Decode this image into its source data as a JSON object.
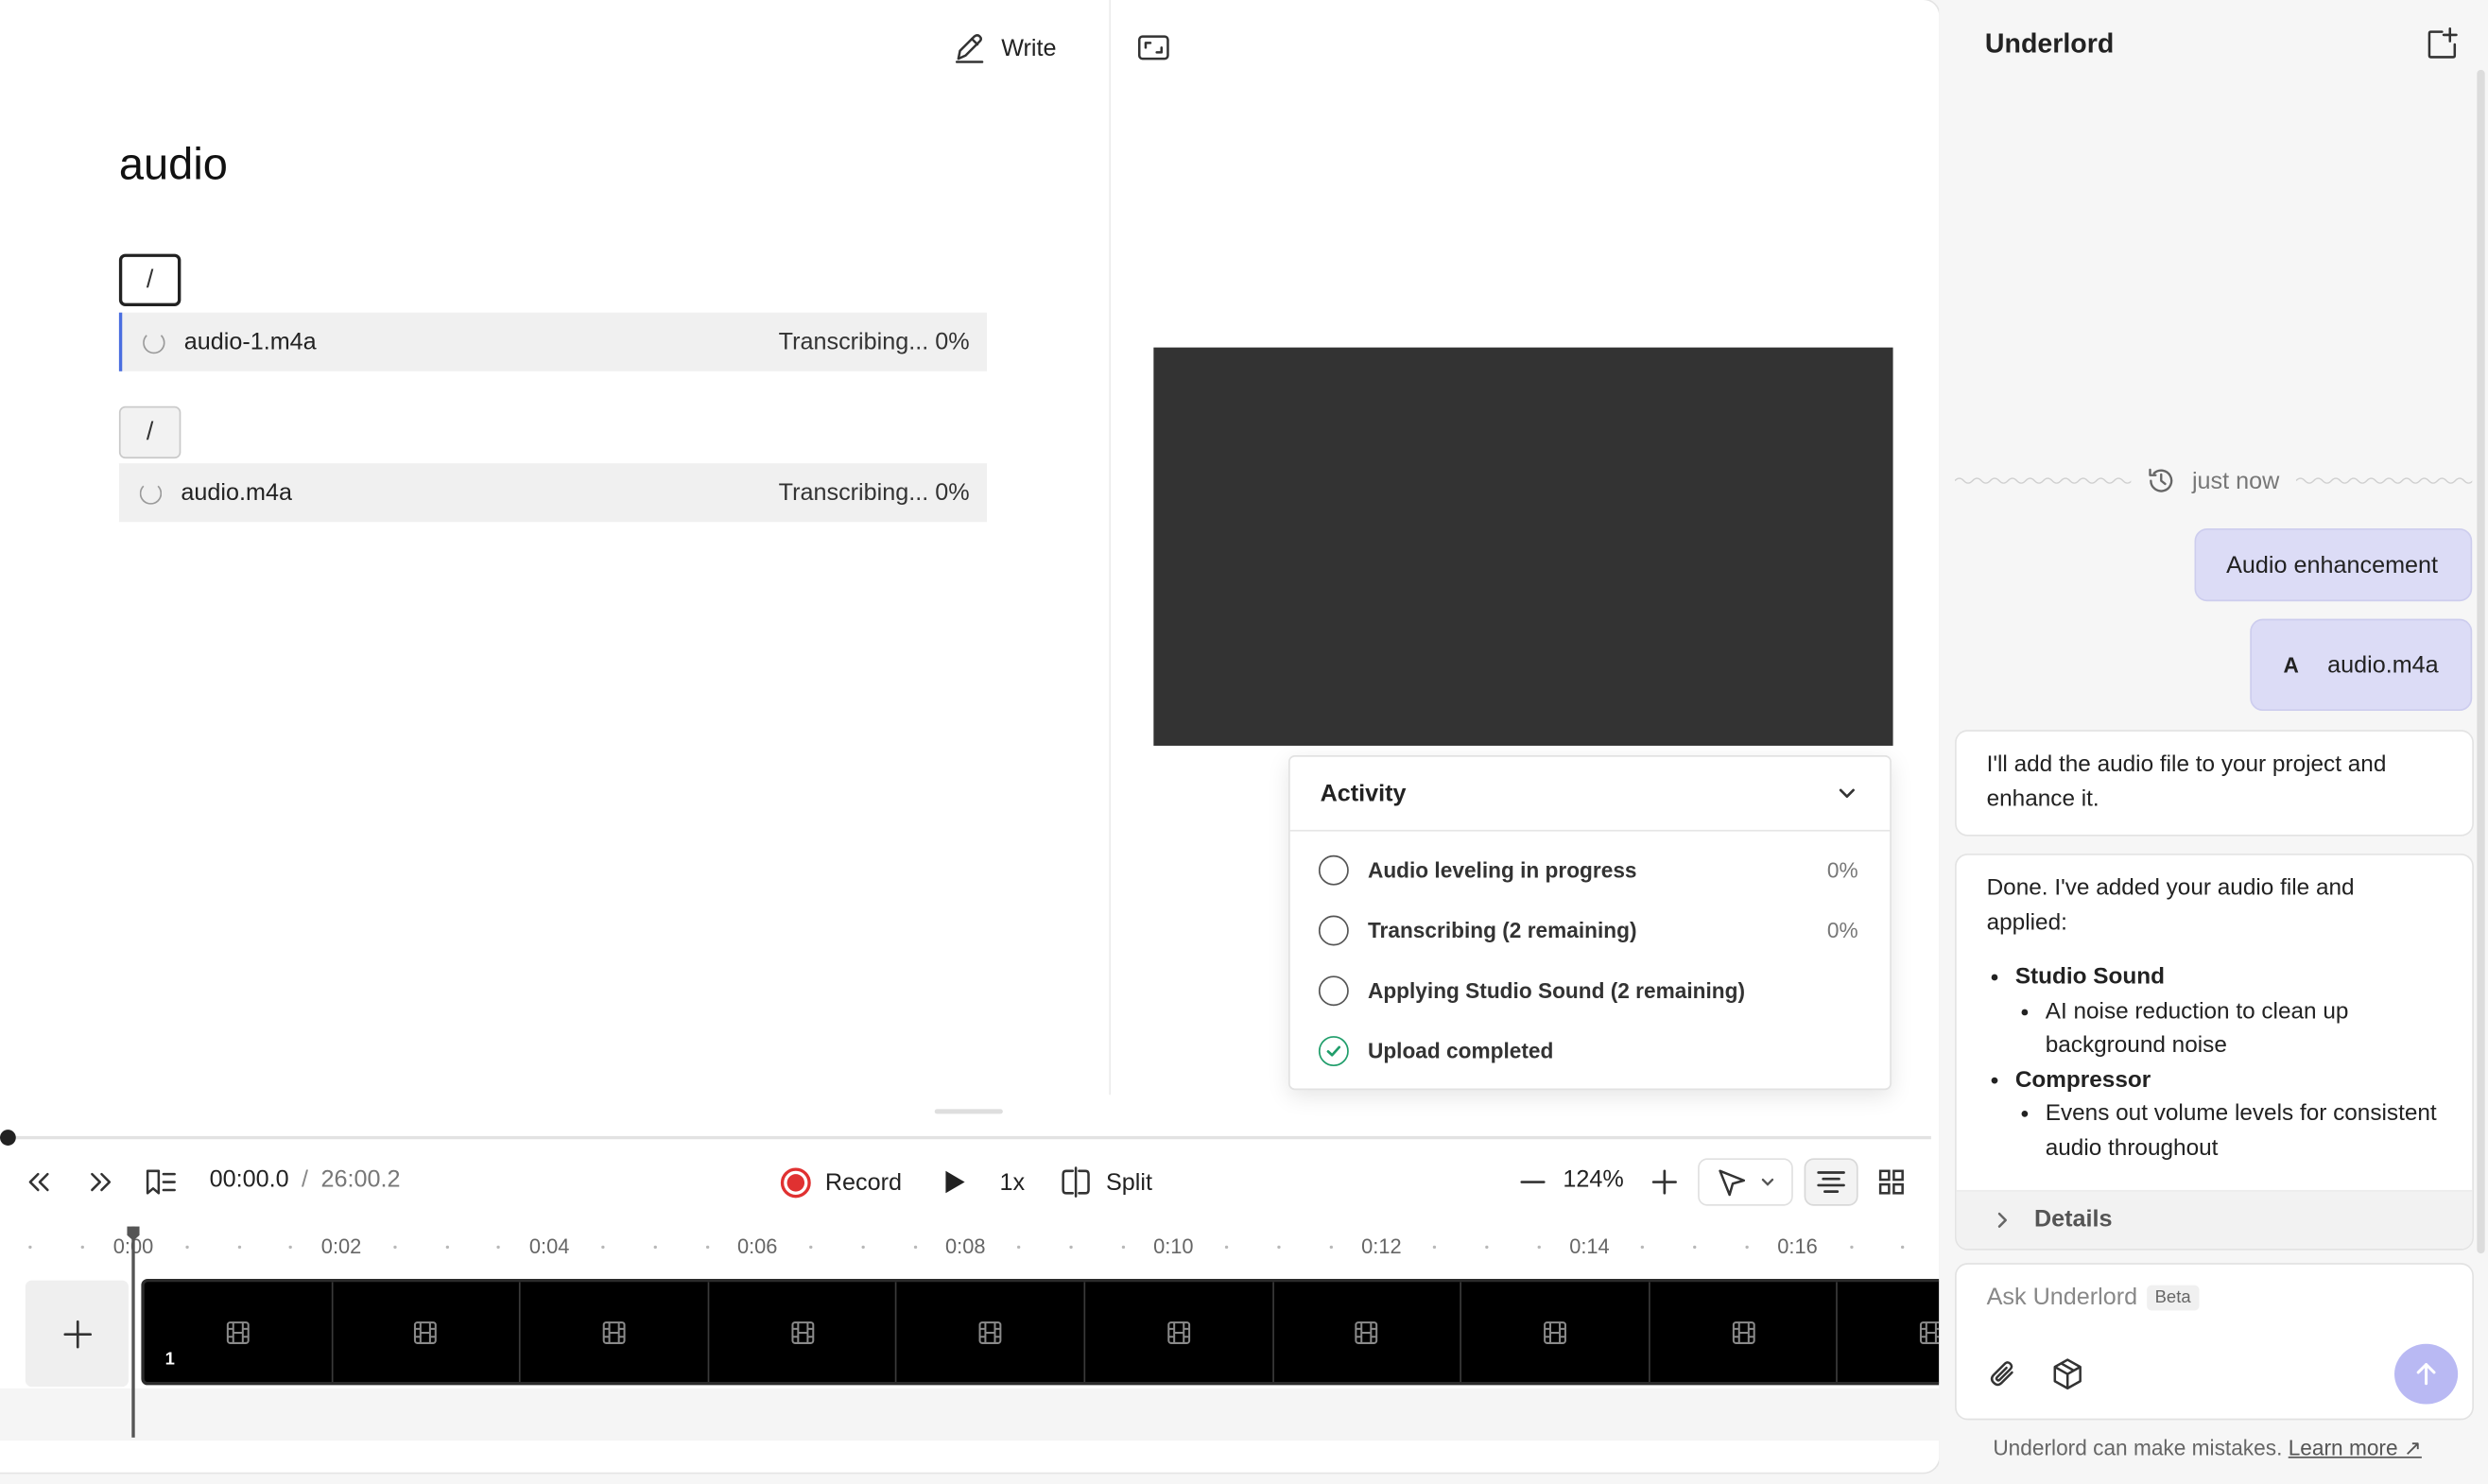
{
  "toolbar": {
    "write_label": "Write"
  },
  "document": {
    "title": "audio",
    "slash": "/",
    "files": [
      {
        "name": "audio-1.m4a",
        "status": "Transcribing... 0%"
      },
      {
        "name": "audio.m4a",
        "status": "Transcribing... 0%"
      }
    ]
  },
  "activity": {
    "title": "Activity",
    "items": [
      {
        "label": "Audio leveling in progress",
        "percent": "0%",
        "done": false
      },
      {
        "label": "Transcribing (2 remaining)",
        "percent": "0%",
        "done": false
      },
      {
        "label": "Applying Studio Sound (2 remaining)",
        "percent": "",
        "done": false
      },
      {
        "label": "Upload completed",
        "percent": "",
        "done": true
      }
    ]
  },
  "transport": {
    "current_time": "00:00.0",
    "separator": "/",
    "duration": "26:00.2",
    "record_label": "Record",
    "speed": "1x",
    "split_label": "Split",
    "zoom": "124%"
  },
  "ruler": {
    "ticks": [
      "0:00",
      "0:02",
      "0:04",
      "0:06",
      "0:08",
      "0:10",
      "0:12",
      "0:14",
      "0:16"
    ]
  },
  "timeline": {
    "clip_number": "1",
    "frame_count": 10
  },
  "sidebar": {
    "title": "Underlord",
    "timestamp": "just now",
    "user_message": "Audio enhancement",
    "attachment": {
      "initial": "A",
      "name": "audio.m4a"
    },
    "ai_message_1": "I'll add the audio file to your project and enhance it.",
    "ai_message_2": {
      "intro": "Done. I've added your audio file and applied:",
      "items": [
        {
          "title": "Studio Sound",
          "detail": "AI noise reduction to clean up background noise"
        },
        {
          "title": "Compressor",
          "detail": "Evens out volume levels for consistent audio throughout"
        }
      ],
      "details_label": "Details"
    },
    "composer": {
      "placeholder": "Ask Underlord",
      "badge": "Beta"
    },
    "disclaimer": "Underlord can make mistakes.",
    "learn_more": "Learn more ↗"
  }
}
